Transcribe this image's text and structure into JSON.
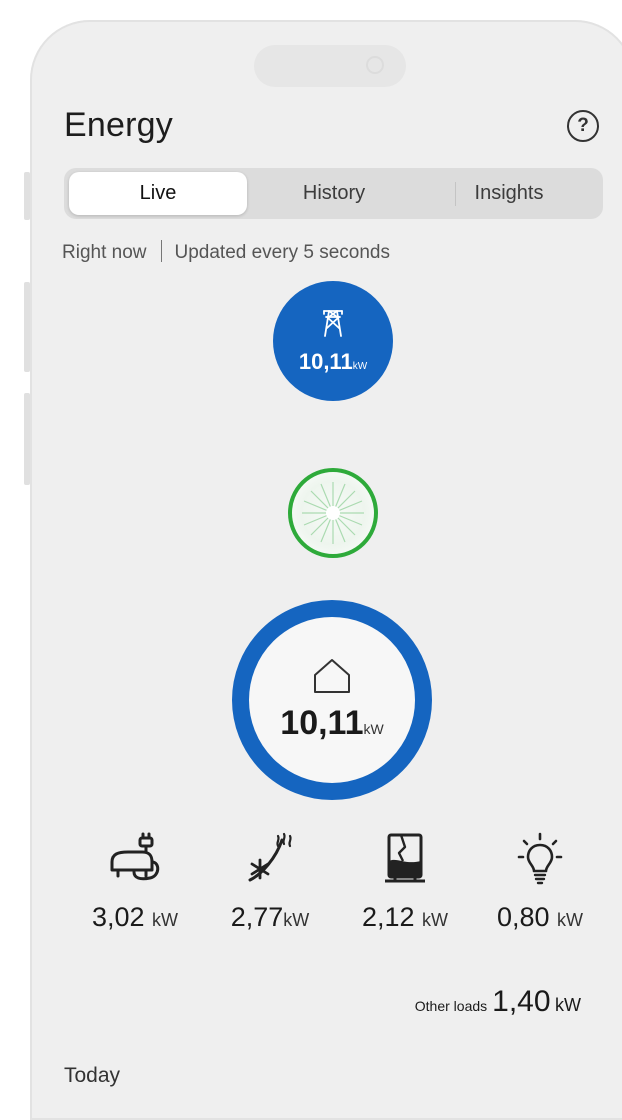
{
  "header": {
    "title": "Energy",
    "help_icon": "question-circle-icon"
  },
  "tabs": [
    {
      "label": "Live",
      "active": true
    },
    {
      "label": "History",
      "active": false
    },
    {
      "label": "Insights",
      "active": false
    }
  ],
  "status": {
    "left": "Right now",
    "right": "Updated every 5 seconds"
  },
  "grid": {
    "icon": "power-pylon-icon",
    "value": "10,11",
    "unit": "kW",
    "color": "#1565c0"
  },
  "inverter": {
    "icon": "solar-flow-icon",
    "color": "#2eaa3a"
  },
  "house": {
    "icon": "house-icon",
    "value": "10,11",
    "unit": "kW",
    "ring_color": "#1565c0"
  },
  "loads": [
    {
      "icon": "ev-charger-icon",
      "value": "3,02",
      "unit": "kW"
    },
    {
      "icon": "heat-pump-icon",
      "value": "2,77",
      "unit": "kW"
    },
    {
      "icon": "water-heater-icon",
      "value": "2,12",
      "unit": "kW"
    },
    {
      "icon": "lightbulb-icon",
      "value": "0,80",
      "unit": "kW"
    }
  ],
  "other_loads": {
    "label": "Other loads",
    "value": "1,40",
    "unit": "kW"
  },
  "section": {
    "title": "Today"
  }
}
